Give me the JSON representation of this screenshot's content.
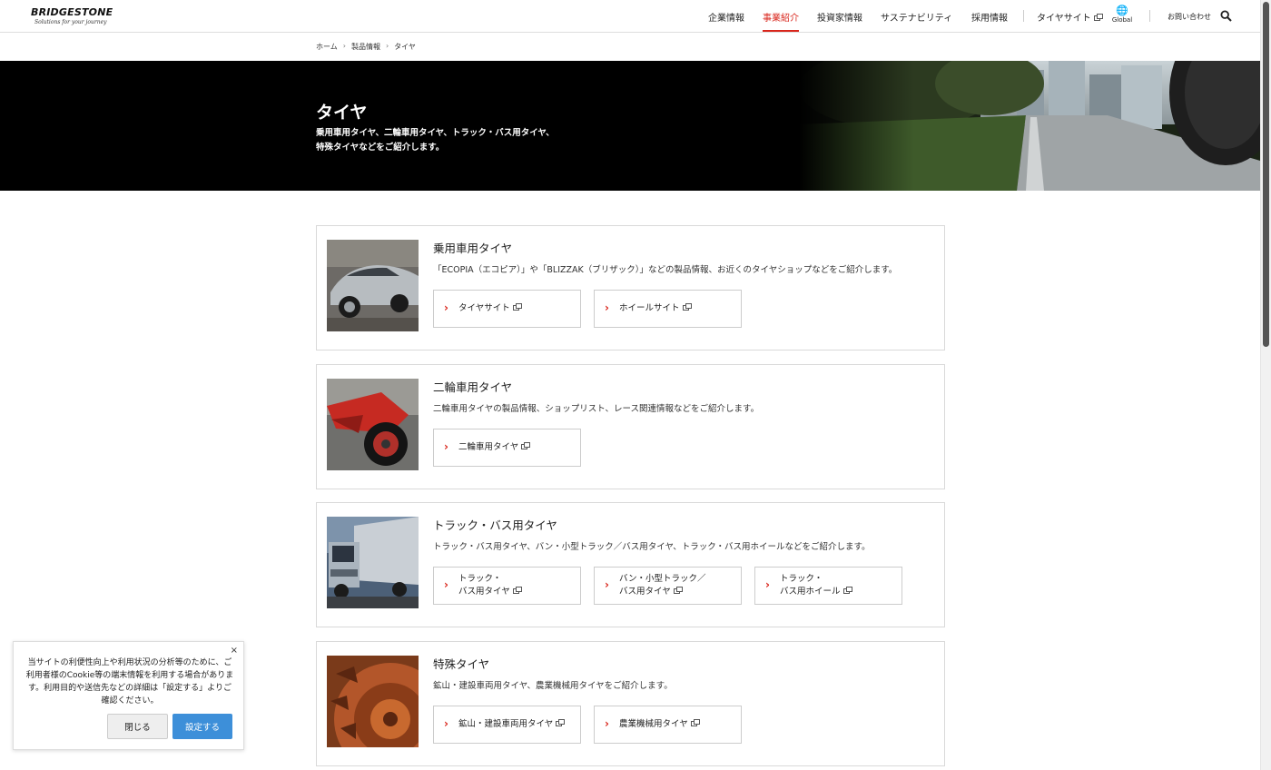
{
  "header": {
    "logo": {
      "main": "BRIDGESTONE",
      "sub": "Solutions for your journey"
    },
    "nav": [
      {
        "label": "企業情報"
      },
      {
        "label": "事業紹介",
        "active": true
      },
      {
        "label": "投資家情報"
      },
      {
        "label": "サステナビリティ"
      },
      {
        "label": "採用情報"
      }
    ],
    "tire_site": "タイヤサイト",
    "global": "Global",
    "contact": "お問い合わせ",
    "accent_color": "#d9261c"
  },
  "breadcrumb": [
    "ホーム",
    "製品情報",
    "タイヤ"
  ],
  "hero": {
    "title": "タイヤ",
    "subtitle": "乗用車用タイヤ、二輪車用タイヤ、トラック・バス用タイヤ、特殊タイヤなどをご紹介します。"
  },
  "cards": [
    {
      "title": "乗用車用タイヤ",
      "desc": "「ECOPIA（エコピア）」や「BLIZZAK（ブリザック）」などの製品情報、お近くのタイヤショップなどをご紹介します。",
      "buttons": [
        "タイヤサイト",
        "ホイールサイト"
      ]
    },
    {
      "title": "二輪車用タイヤ",
      "desc": "二輪車用タイヤの製品情報、ショップリスト、レース関連情報などをご紹介します。",
      "buttons": [
        "二輪車用タイヤ"
      ]
    },
    {
      "title": "トラック・バス用タイヤ",
      "desc": "トラック・バス用タイヤ、バン・小型トラック／バス用タイヤ、トラック・バス用ホイールなどをご紹介します。",
      "buttons": [
        "トラック・\nバス用タイヤ",
        "バン・小型トラック／\nバス用タイヤ",
        "トラック・\nバス用ホイール"
      ]
    },
    {
      "title": "特殊タイヤ",
      "desc": "鉱山・建設車両用タイヤ、農業機械用タイヤをご紹介します。",
      "buttons": [
        "鉱山・建設車両用タイヤ",
        "農業機械用タイヤ"
      ]
    }
  ],
  "cookie": {
    "text": "当サイトの利便性向上や利用状況の分析等のために、ご利用者様のCookie等の端末情報を利用する場合があります。利用目的や送信先などの詳細は「設定する」よりご確認ください。",
    "close_label": "閉じる",
    "settings_label": "設定する",
    "dismiss": "×",
    "button_color": "#3d8fd9"
  }
}
